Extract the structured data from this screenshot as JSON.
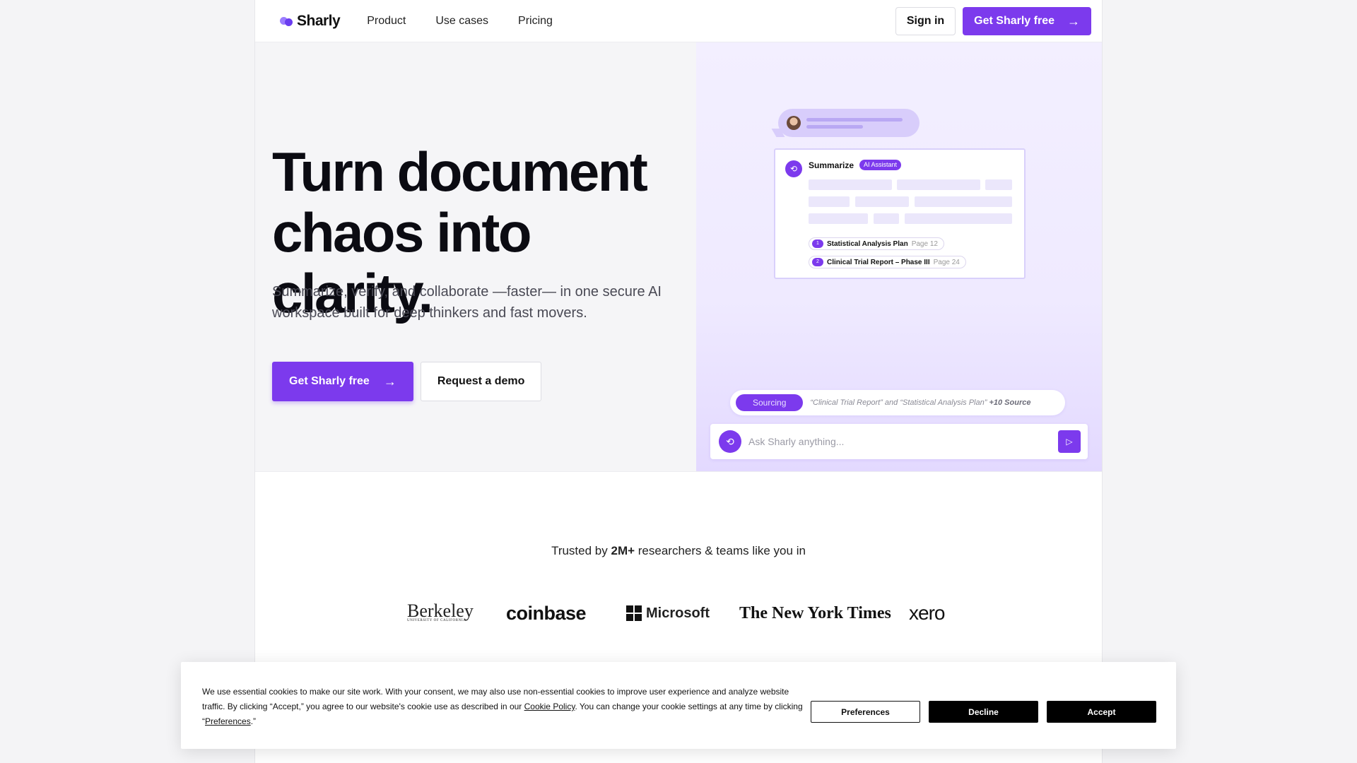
{
  "nav": {
    "brand": "Sharly",
    "links": [
      "Product",
      "Use cases",
      "Pricing"
    ],
    "signin": "Sign in",
    "cta": "Get Sharly free"
  },
  "hero": {
    "title_line1": "Turn document",
    "title_line2": "chaos into clarity.",
    "subtitle": "Summarize, verify, and collaborate  —faster— in one secure AI workspace built for deep thinkers and fast movers.",
    "cta_primary": "Get Sharly free",
    "cta_secondary": "Request a demo"
  },
  "preview": {
    "card_title": "Summarize",
    "card_badge": "AI Assistant",
    "citations": [
      {
        "num": "1",
        "title": "Statistical Analysis Plan",
        "page": "Page 12"
      },
      {
        "num": "2",
        "title": "Clinical Trial Report – Phase III",
        "page": "Page 24"
      }
    ],
    "sourcing_label": "Sourcing",
    "sourcing_text": "“Clinical Trial Report” and “Statistical Analysis Plan”",
    "sourcing_more": "+10 Source",
    "ask_placeholder": "Ask Sharly anything..."
  },
  "trusted": {
    "prefix": "Trusted by",
    "count": "2M+",
    "suffix": "researchers & teams like you in"
  },
  "logos": {
    "berkeley": "Berkeley",
    "berkeley_sub": "UNIVERSITY OF CALIFORNIA",
    "coinbase": "coinbase",
    "microsoft": "Microsoft",
    "nyt": "The New York Times",
    "xero": "xero"
  },
  "cookie": {
    "text_1": "We use essential cookies to make our site work. With your consent, we may also use non-essential cookies to improve user experience and analyze website traffic. By clicking “Accept,” you agree to our website's cookie use as described in our ",
    "policy_link": "Cookie Policy",
    "text_2": ". You can change your cookie settings at any time by clicking “",
    "prefs_link": "Preferences",
    "text_3": ".”",
    "preferences": "Preferences",
    "decline": "Decline",
    "accept": "Accept"
  },
  "colors": {
    "accent": "#7c3aed",
    "hero_left_bg": "#f5f5f7",
    "hero_right_bg": "#efeaff"
  }
}
